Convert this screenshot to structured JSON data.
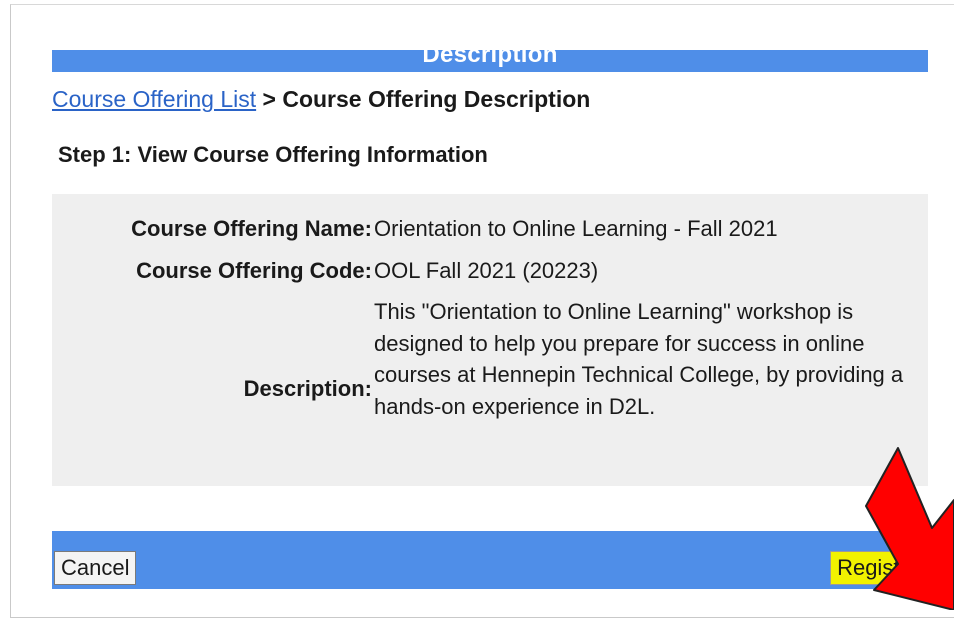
{
  "header": {
    "title": "Description"
  },
  "breadcrumb": {
    "link_label": "Course Offering List",
    "separator": ">",
    "current": "Course Offering Description"
  },
  "step": {
    "heading": "Step 1: View Course Offering Information"
  },
  "info": {
    "name_label": "Course Offering Name:",
    "name_value": "Orientation to Online Learning - Fall 2021",
    "code_label": "Course Offering Code:",
    "code_value": "OOL Fall 2021 (20223)",
    "description_label": "Description:",
    "description_value": "This \"Orientation to Online Learning\" workshop is designed to help you prepare for success in online courses at Hennepin Technical College, by providing a hands-on experience in D2L."
  },
  "actions": {
    "cancel_label": "Cancel",
    "register_label": "Register"
  },
  "colors": {
    "bar": "#4f8ee8",
    "link": "#2a63c7",
    "highlight": "#f2f200",
    "arrow": "#ff0000"
  },
  "annotation": {
    "icon": "red-arrow-icon"
  }
}
